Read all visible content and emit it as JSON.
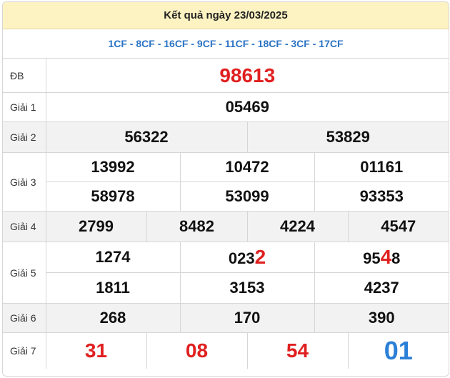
{
  "header": {
    "title": "Kết quả ngày 23/03/2025"
  },
  "codes": "1CF - 8CF - 16CF - 9CF - 11CF - 18CF - 3CF - 17CF",
  "prizes": {
    "db": {
      "label": "ĐB",
      "values": [
        "98613"
      ]
    },
    "g1": {
      "label": "Giải 1",
      "values": [
        "05469"
      ]
    },
    "g2": {
      "label": "Giải 2",
      "values": [
        "56322",
        "53829"
      ]
    },
    "g3": {
      "label": "Giải 3",
      "values": [
        "13992",
        "10472",
        "01161",
        "58978",
        "53099",
        "93353"
      ]
    },
    "g4": {
      "label": "Giải 4",
      "values": [
        "2799",
        "8482",
        "4224",
        "4547"
      ]
    },
    "g5": {
      "label": "Giải 5",
      "values": [
        "1274",
        "1811",
        "3153",
        "4237"
      ],
      "split": [
        {
          "pre": "023",
          "hl": "2",
          "post": ""
        },
        {
          "pre": "95",
          "hl": "4",
          "post": "8"
        }
      ]
    },
    "g6": {
      "label": "Giải 6",
      "values": [
        "268",
        "170",
        "390"
      ]
    },
    "g7": {
      "label": "Giải 7",
      "values": [
        "31",
        "08",
        "54",
        "01"
      ]
    }
  },
  "colors": {
    "accent_red": "#e02020",
    "accent_blue": "#2a7fd6",
    "header_bg": "#fdf3c2",
    "code_blue": "#2a73c4"
  }
}
